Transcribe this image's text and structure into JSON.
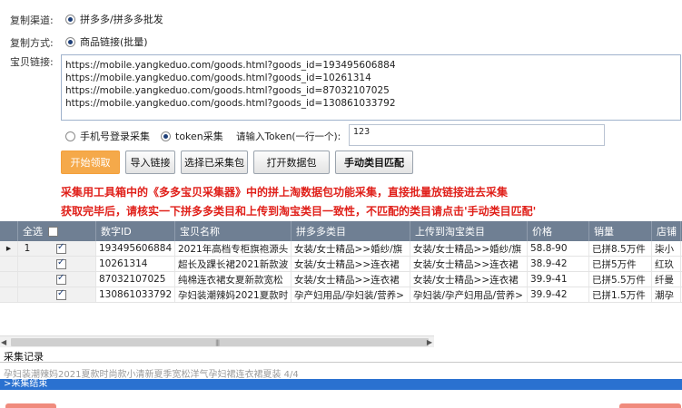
{
  "channel": {
    "label": "复制渠道:",
    "option": "拼多多/拼多多批发"
  },
  "method": {
    "label": "复制方式:",
    "option": "商品链接(批量)"
  },
  "links": {
    "label": "宝贝链接:",
    "lines": [
      "https://mobile.yangkeduo.com/goods.html?goods_id=193495606884",
      "https://mobile.yangkeduo.com/goods.html?goods_id=10261314",
      "https://mobile.yangkeduo.com/goods.html?goods_id=87032107025",
      "https://mobile.yangkeduo.com/goods.html?goods_id=130861033792"
    ]
  },
  "collect": {
    "phone_option": "手机号登录采集",
    "token_option": "token采集",
    "token_prompt": "请输入Token(一行一个):",
    "token_value": "123"
  },
  "buttons": {
    "start": "开始领取",
    "import": "导入链接",
    "select_pkg": "选择已采集包",
    "open_pkg": "打开数据包",
    "match": "手动类目匹配"
  },
  "notice": {
    "line1": "采集用工具箱中的《多多宝贝采集器》中的拼上淘数据包功能采集，直接批量放链接进去采集",
    "line2": "获取完毕后，请核实一下拼多多类目和上传到淘宝类目一致性，不匹配的类目请点击'手动类目匹配'"
  },
  "table": {
    "headers": [
      "全选",
      "数字ID",
      "宝贝名称",
      "拼多多类目",
      "上传到淘宝类目",
      "价格",
      "销量",
      "店铺"
    ],
    "rows": [
      {
        "num": "1",
        "id": "193495606884",
        "name": "2021年高档专柜旗袍源头",
        "pdd": "女装/女士精品>>婚纱/旗",
        "tb": "女装/女士精品>>婚纱/旗",
        "price": "58.8-90",
        "sales": "已拼8.5万件",
        "shop": "柒小"
      },
      {
        "num": "2",
        "id": "10261314",
        "name": "超长及踝长裙2021新款波",
        "pdd": "女装/女士精品>>连衣裙",
        "tb": "女装/女士精品>>连衣裙",
        "price": "38.9-42",
        "sales": "已拼5万件",
        "shop": "红玖"
      },
      {
        "num": "3",
        "id": "87032107025",
        "name": "纯棉连衣裙女夏新款宽松",
        "pdd": "女装/女士精品>>连衣裙",
        "tb": "女装/女士精品>>连衣裙",
        "price": "39.9-41",
        "sales": "已拼5.5万件",
        "shop": "纤曼"
      },
      {
        "num": "4",
        "id": "130861033792",
        "name": "孕妇装潮辣妈2021夏款时",
        "pdd": "孕产妇用品/孕妇装/营养>",
        "tb": "孕妇装/孕产妇用品/营养>",
        "price": "39.9-42",
        "sales": "已拼1.5万件",
        "shop": "潮孕"
      }
    ]
  },
  "log": {
    "title": "采集记录",
    "line1": "孕妇装潮辣妈2021夏款时尚款小清新夏季宽松洋气孕妇裙连衣裙夏装  4/4",
    "line2": ">采集结束"
  },
  "colors": {
    "header_bg": "#6f7f93",
    "start_button": "#f5a94a",
    "notice_text": "#e0201a",
    "log_highlight": "#2a71d0"
  }
}
